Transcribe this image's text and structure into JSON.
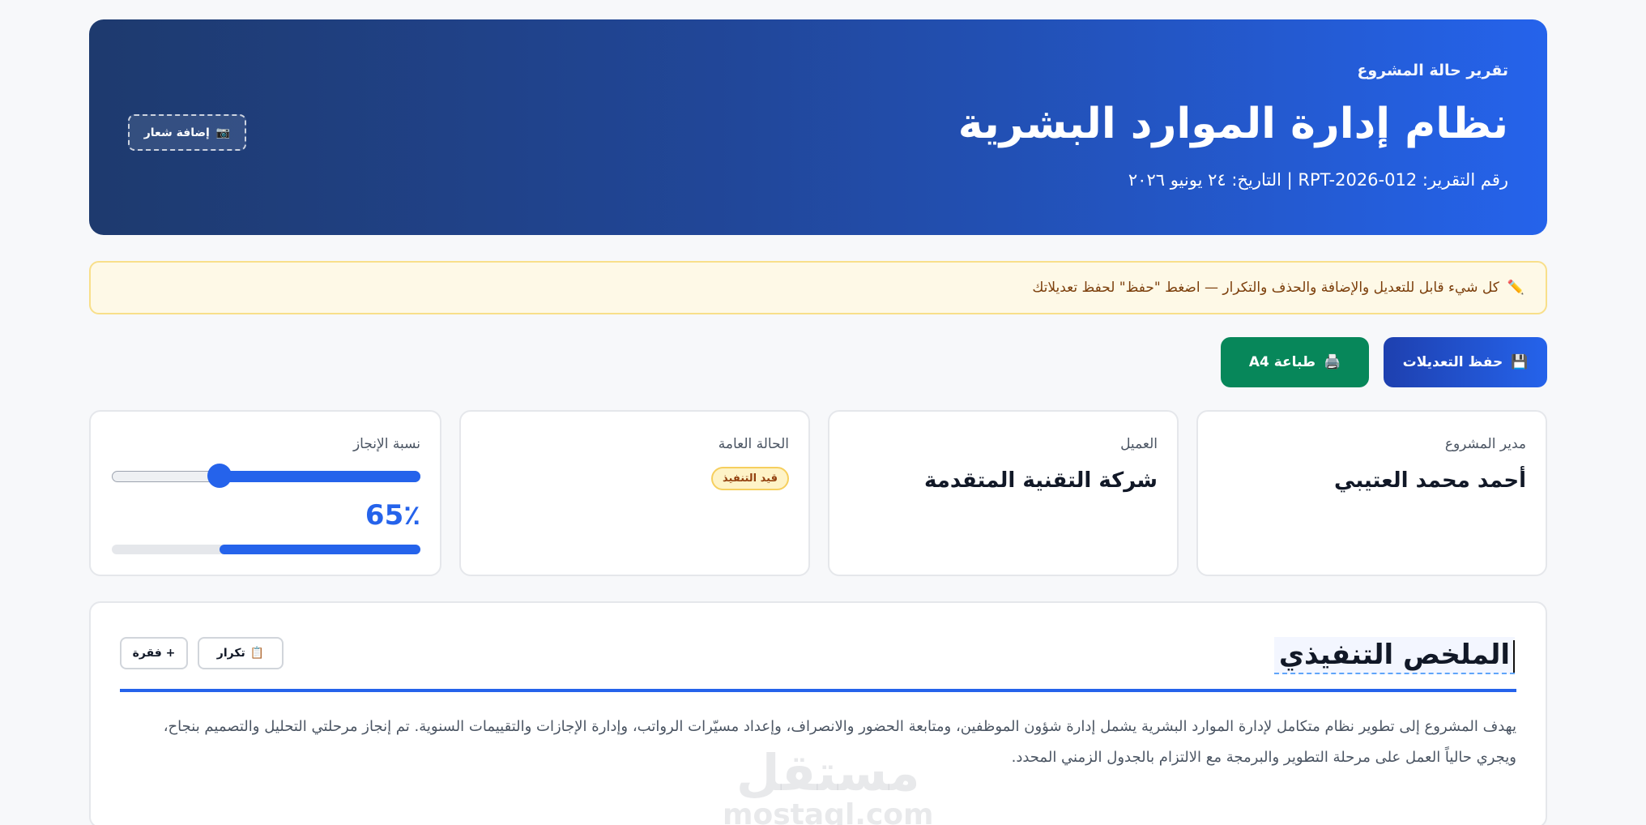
{
  "header": {
    "subtitle": "تقرير حالة المشروع",
    "title": "نظام إدارة الموارد البشرية",
    "meta": "رقم التقرير: RPT-2026-012 | التاريخ: ٢٤ يونيو ٢٠٢٦",
    "logo_button": {
      "icon": "camera-icon",
      "icon_glyph": "📷",
      "label": "إضافة شعار"
    }
  },
  "notice": {
    "icon": "pencil-icon",
    "icon_glyph": "✏️",
    "text": "كل شيء قابل للتعديل والإضافة والحذف والتكرار — اضغط \"حفظ\" لحفظ تعديلاتك"
  },
  "actions": {
    "save": {
      "icon": "floppy-disk-icon",
      "icon_glyph": "💾",
      "label": "حفظ التعديلات"
    },
    "print": {
      "icon": "printer-icon",
      "icon_glyph": "🖨️",
      "label": "طباعة A4"
    }
  },
  "cards": {
    "manager": {
      "label": "مدير المشروع",
      "value": "أحمد محمد العتيبي"
    },
    "client": {
      "label": "العميل",
      "value": "شركة التقنية المتقدمة"
    },
    "status": {
      "label": "الحالة العامة",
      "badge": "قيد التنفيذ"
    },
    "progress": {
      "label": "نسبة الإنجاز",
      "percent": 65,
      "display": "65٪"
    }
  },
  "section": {
    "title": "الملخص التنفيذي",
    "duplicate_button": {
      "icon": "clipboard-icon",
      "icon_glyph": "📋",
      "label": "تكرار"
    },
    "add_button": {
      "label": "+ فقرة"
    },
    "body": "يهدف المشروع إلى تطوير نظام متكامل لإدارة الموارد البشرية يشمل إدارة شؤون الموظفين، ومتابعة الحضور والانصراف، وإعداد مسيّرات الرواتب، وإدارة الإجازات والتقييمات السنوية. تم إنجاز مرحلتي التحليل والتصميم بنجاح، ويجري حالياً العمل على مرحلة التطوير والبرمجة مع الالتزام بالجدول الزمني المحدد."
  },
  "watermark": {
    "line1": "مستقل",
    "line2": "mostaql.com"
  },
  "colors": {
    "primary": "#2563eb",
    "header_dark": "#1e3a6e",
    "print_green": "#07875a",
    "notice_bg": "#fef9e7",
    "badge_bg": "#fef3c7"
  }
}
